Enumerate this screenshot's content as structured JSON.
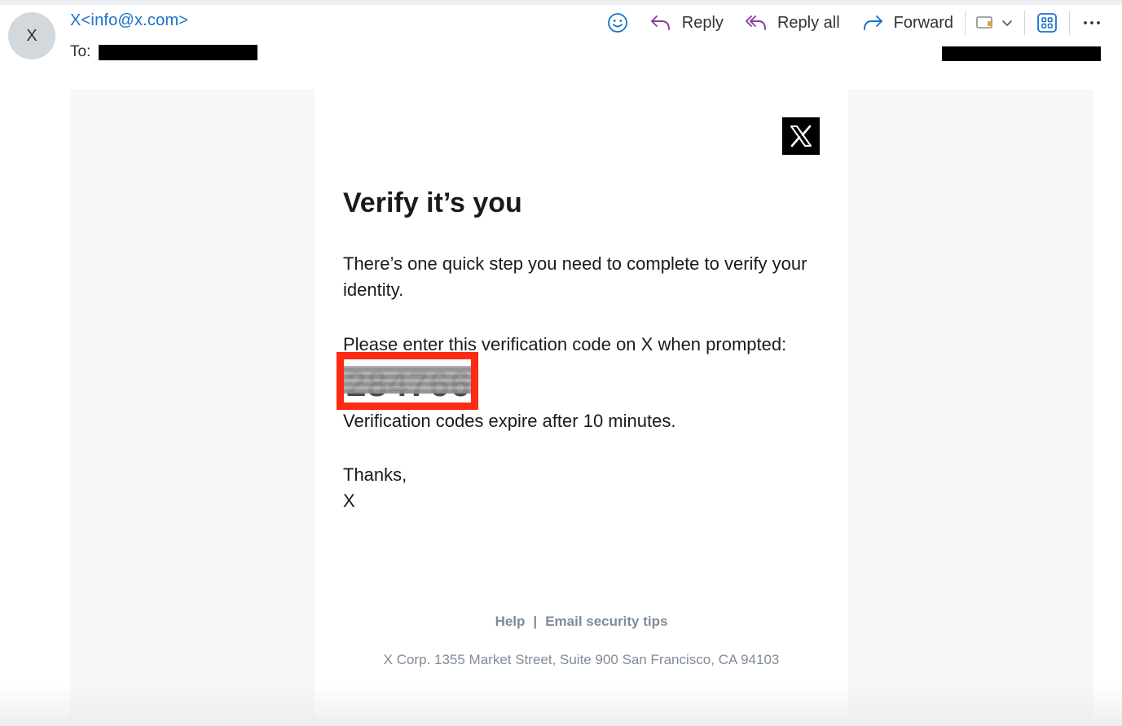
{
  "header": {
    "avatar_initial": "X",
    "sender": "X<info@x.com>",
    "to_label": "To:"
  },
  "toolbar": {
    "reply_label": "Reply",
    "reply_all_label": "Reply all",
    "forward_label": "Forward",
    "icons": [
      "smiley-icon",
      "reply-icon",
      "reply-all-icon",
      "forward-icon",
      "tag-icon",
      "chevron-down-icon",
      "apps-icon",
      "more-icon"
    ],
    "accent_color": "#1a73c8",
    "reply_icon_color": "#8a3f9e"
  },
  "email": {
    "logo": "X",
    "headline": "Verify it’s you",
    "intro": "There’s one quick step you need to complete to verify your identity.",
    "prompt": "Please enter this verification code on X when prompted:",
    "code": "284766",
    "expiry": "Verification codes expire after 10 minutes.",
    "thanks": "Thanks,",
    "signoff": "X",
    "footer_help": "Help",
    "footer_separator": "|",
    "footer_tips": "Email security tips",
    "footer_address": "X Corp. 1355 Market Street, Suite 900 San Francisco, CA 94103",
    "highlight_color": "#ff2a12"
  }
}
